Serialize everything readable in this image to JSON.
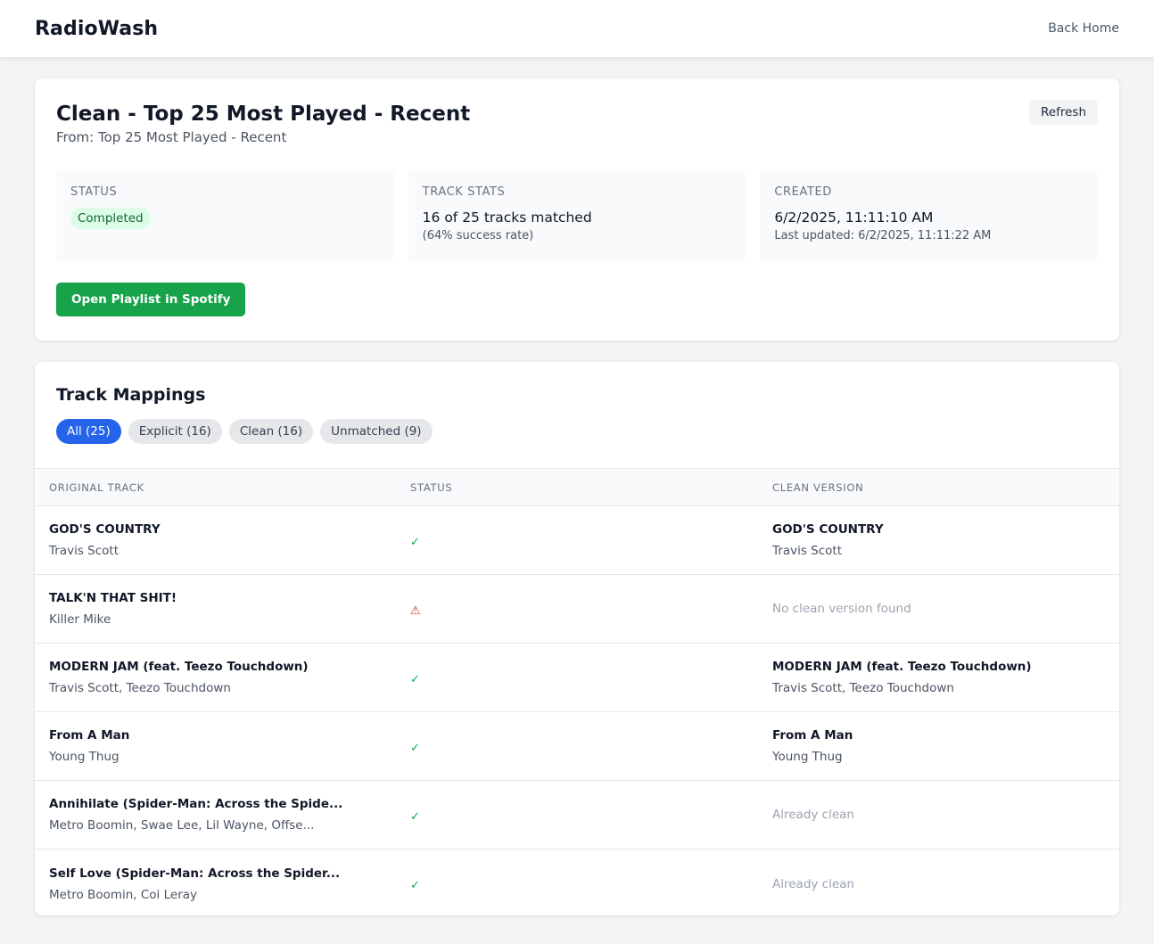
{
  "header": {
    "brand": "RadioWash",
    "back_label": "Back Home"
  },
  "playlist": {
    "title": "Clean - Top 25 Most Played - Recent",
    "subtitle": "From: Top 25 Most Played - Recent",
    "refresh_label": "Refresh",
    "open_spotify_label": "Open Playlist in Spotify"
  },
  "stats": {
    "status": {
      "label": "Status",
      "value": "Completed"
    },
    "track_stats": {
      "label": "Track Stats",
      "value": "16 of 25 tracks matched",
      "sub": "(64% success rate)"
    },
    "created": {
      "label": "Created",
      "value": "6/2/2025, 11:11:10 AM",
      "sub": "Last updated: 6/2/2025, 11:11:22 AM"
    }
  },
  "mappings": {
    "title": "Track Mappings",
    "filters": [
      "All (25)",
      "Explicit (16)",
      "Clean (16)",
      "Unmatched (9)"
    ],
    "columns": [
      "Original Track",
      "Status",
      "Clean Version"
    ],
    "rows": [
      {
        "name": "GOD'S COUNTRY",
        "artist": "Travis Scott",
        "status": "✓",
        "clean_name": "GOD'S COUNTRY",
        "clean_artist": "Travis Scott",
        "note": ""
      },
      {
        "name": "TALK'N THAT SHIT!",
        "artist": "Killer Mike",
        "status": "⚠",
        "clean_name": "",
        "clean_artist": "",
        "note": "No clean version found"
      },
      {
        "name": "MODERN JAM (feat. Teezo Touchdown)",
        "artist": "Travis Scott, Teezo Touchdown",
        "status": "✓",
        "clean_name": "MODERN JAM (feat. Teezo Touchdown)",
        "clean_artist": "Travis Scott, Teezo Touchdown",
        "note": ""
      },
      {
        "name": "From A Man",
        "artist": "Young Thug",
        "status": "✓",
        "clean_name": "From A Man",
        "clean_artist": "Young Thug",
        "note": ""
      },
      {
        "name": "Annihilate (Spider-Man: Across the Spide...",
        "artist": "Metro Boomin, Swae Lee, Lil Wayne, Offse...",
        "status": "✓",
        "clean_name": "",
        "clean_artist": "",
        "note": "Already clean"
      },
      {
        "name": "Self Love (Spider-Man: Across the Spider...",
        "artist": "Metro Boomin, Coi Leray",
        "status": "✓",
        "clean_name": "",
        "clean_artist": "",
        "note": "Already clean"
      }
    ]
  },
  "colors": {
    "accent": "#2563eb",
    "spotify_green": "#16a34a",
    "success": "#16a34a",
    "warning": "#dc2626"
  }
}
